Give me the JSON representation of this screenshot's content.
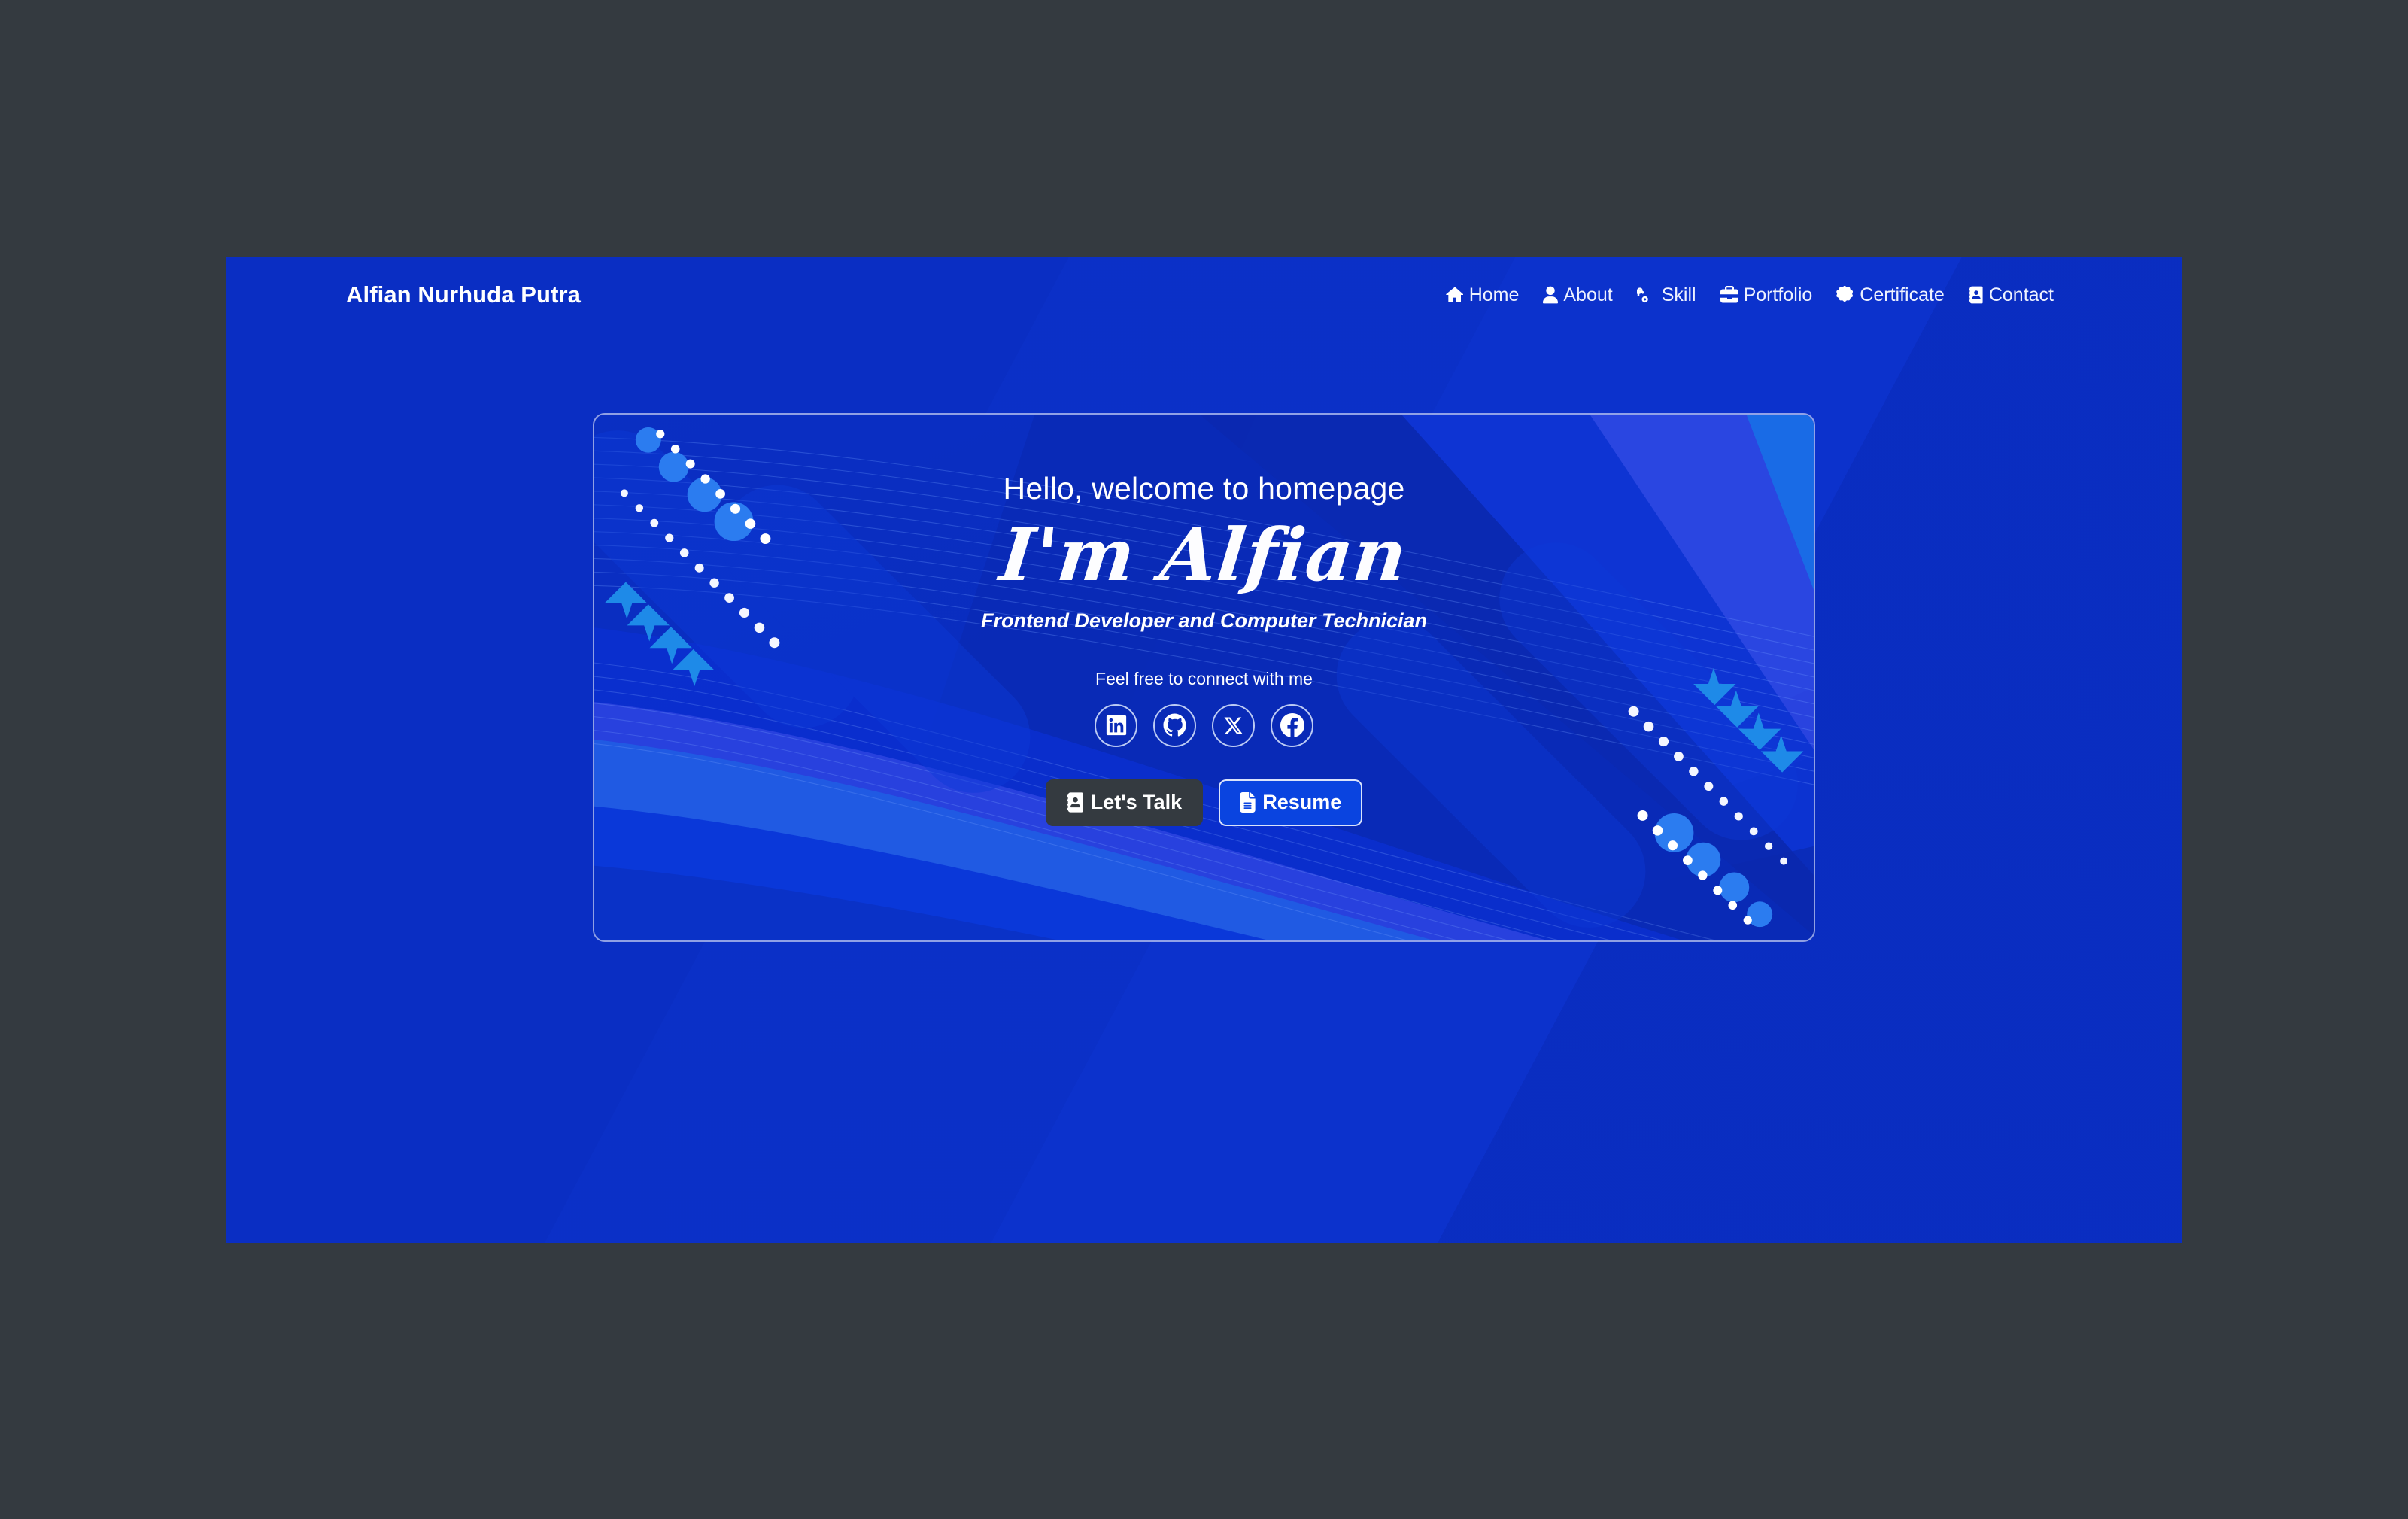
{
  "theme": {
    "outer_bg": "#343a40",
    "page_bg": "#0b2fc4",
    "accent_blue": "#0a44e0",
    "dark_button": "#343a40",
    "light_circle": "#2b7cf0",
    "arrow_blue": "#1e8ae8",
    "dot_white": "#ffffff"
  },
  "navbar": {
    "brand": "Alfian Nurhuda Putra",
    "links": [
      {
        "label": "Home",
        "icon": "home-icon"
      },
      {
        "label": "About",
        "icon": "user-icon"
      },
      {
        "label": "Skill",
        "icon": "gears-icon"
      },
      {
        "label": "Portfolio",
        "icon": "briefcase-icon"
      },
      {
        "label": "Certificate",
        "icon": "certificate-icon"
      },
      {
        "label": "Contact",
        "icon": "address-book-icon"
      }
    ]
  },
  "hero": {
    "welcome": "Hello, welcome to homepage",
    "name": "I'm Alfian",
    "role": "Frontend Developer and Computer Technician",
    "connect_label": "Feel free to connect with me",
    "socials": [
      {
        "name": "linkedin",
        "label": "LinkedIn"
      },
      {
        "name": "github",
        "label": "GitHub"
      },
      {
        "name": "x",
        "label": "X"
      },
      {
        "name": "facebook",
        "label": "Facebook"
      }
    ],
    "buttons": {
      "talk": {
        "label": "Let's Talk",
        "icon": "address-book-icon"
      },
      "resume": {
        "label": "Resume",
        "icon": "file-lines-icon"
      }
    }
  }
}
